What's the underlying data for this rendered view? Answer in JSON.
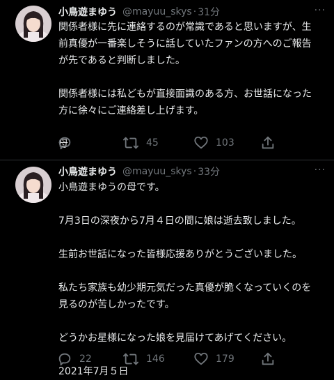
{
  "colors": {
    "background": "#000000",
    "text": "#e7e9ea",
    "muted": "#71767b",
    "divider": "#2f3336"
  },
  "tweets": [
    {
      "author": "小鳥遊まゆう",
      "handle": "@mayuu_skys",
      "separator": "·",
      "time": "31分",
      "more": "···",
      "lines": [
        "関係者様に先に連絡するのが常識であると思いますが、生",
        "前真優が一番楽しそうに話していたファンの方へのご報告",
        "が先であると判断しました。",
        "",
        "関係者様には私どもが直接面識のある方、お世話になった",
        "方に徐々にご連絡差し上げます。",
        "",
        "母"
      ],
      "actions": {
        "reply_icon": "reply-icon",
        "reply_count": "",
        "retweet_icon": "retweet-icon",
        "retweet_count": "45",
        "like_icon": "heart-icon",
        "like_count": "103",
        "share_icon": "share-icon"
      }
    },
    {
      "author": "小鳥遊まゆう",
      "handle": "@mayuu_skys",
      "separator": "·",
      "time": "33分",
      "more": "···",
      "lines": [
        "小鳥遊まゆうの母です。",
        "",
        "7月3日の深夜から7月４日の間に娘は逝去致しました。",
        "",
        "生前お世話になった皆様応援ありがとうございました。",
        "",
        "私たち家族も幼少期元気だった真優が脆くなっていくのを",
        "見るのが苦しかったです。",
        "",
        "どうかお星様になった娘を見届けてあげてください。",
        "",
        "2021年7月５日"
      ],
      "actions": {
        "reply_icon": "reply-icon",
        "reply_count": "22",
        "retweet_icon": "retweet-icon",
        "retweet_count": "146",
        "like_icon": "heart-icon",
        "like_count": "179",
        "share_icon": "share-icon"
      }
    }
  ]
}
